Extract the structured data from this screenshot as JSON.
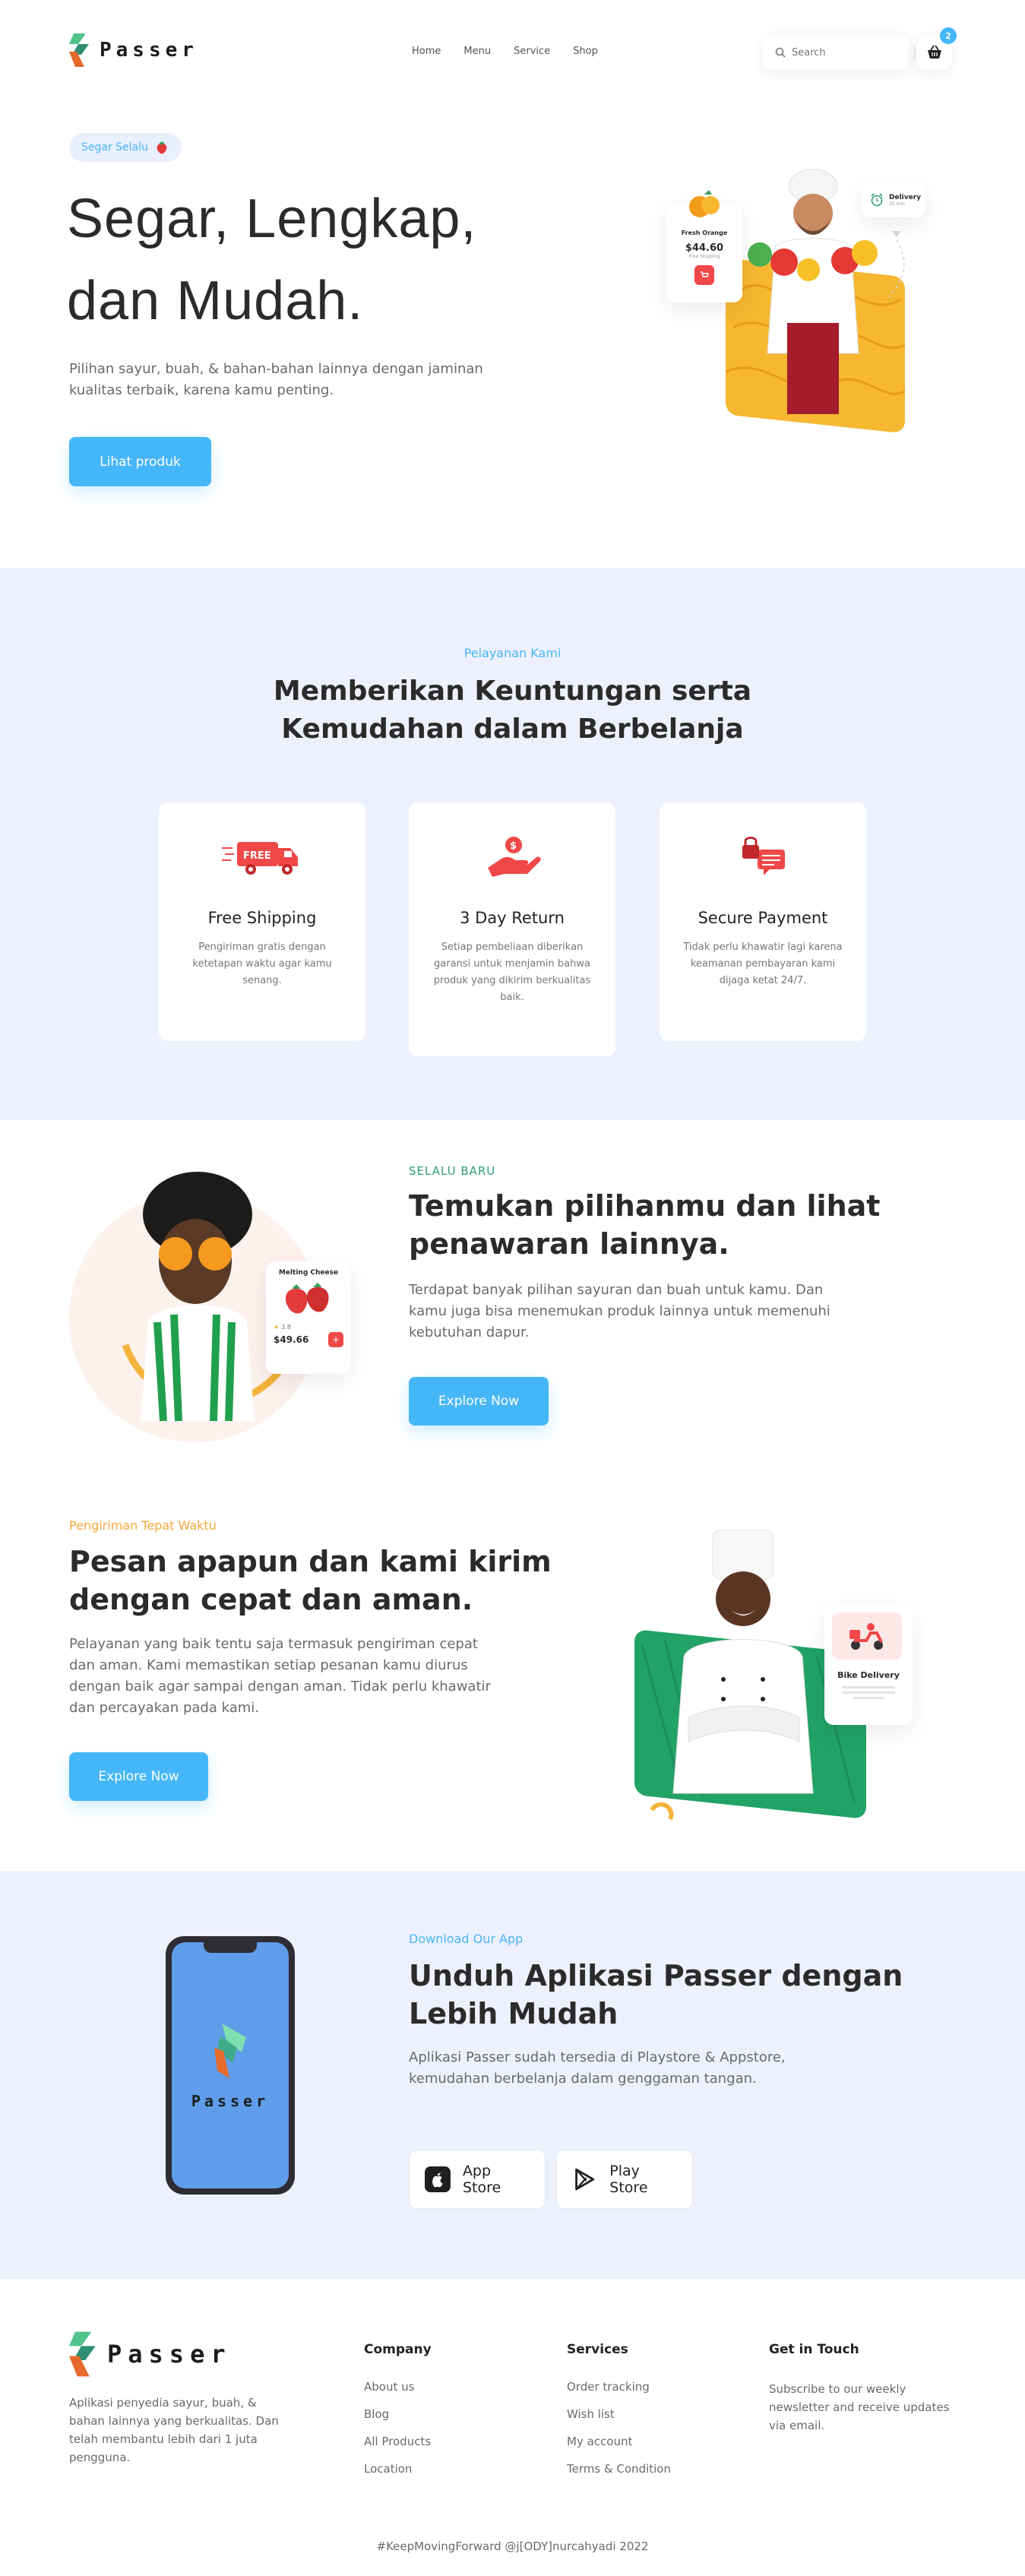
{
  "brand": {
    "name": "Passer",
    "accent": "#45b6f8",
    "green": "#2f9e74",
    "orange": "#f4a63b",
    "red": "#f04848"
  },
  "nav": {
    "links": [
      "Home",
      "Menu",
      "Service",
      "Shop"
    ],
    "search_placeholder": "Search",
    "cart_count": "2"
  },
  "hero": {
    "pill": "Segar Selalu",
    "title_line1": "Segar, Lengkap,",
    "title_line2": "dan Mudah.",
    "description": "Pilihan sayur, buah, & bahan-bahan lainnya dengan jaminan kualitas terbaik, karena kamu penting.",
    "cta": "Lihat produk",
    "product_card": {
      "name": "Fresh Orange",
      "price": "$44.60",
      "note": "Free Shipping"
    },
    "delivery_card": {
      "title": "Delivery",
      "subtitle": "20 min"
    }
  },
  "services": {
    "kicker": "Pelayanan Kami",
    "title_line1": "Memberikan Keuntungan serta",
    "title_line2": "Kemudahan dalam Berbelanja",
    "items": [
      {
        "icon": "free-truck-icon",
        "title": "Free Shipping",
        "desc": "Pengiriman gratis dengan ketetapan waktu agar kamu senang."
      },
      {
        "icon": "hand-money-icon",
        "title": "3 Day Return",
        "desc": "Setiap pembeliaan diberikan garansi untuk menjamin bahwa produk yang dikirim berkualitas baik."
      },
      {
        "icon": "secure-chat-icon",
        "title": "Secure Payment",
        "desc": "Tidak perlu khawatir lagi karena keamanan pembayaran kami dijaga ketat 24/7."
      }
    ]
  },
  "discover": {
    "kicker": "SELALU BARU",
    "title_line1": "Temukan pilihanmu dan lihat",
    "title_line2": "penawaran lainnya.",
    "description": "Terdapat banyak pilihan sayuran dan buah untuk kamu. Dan kamu juga bisa menemukan produk lainnya untuk memenuhi kebutuhan dapur.",
    "cta": "Explore Now",
    "product_card": {
      "name": "Melting Cheese",
      "rating": "3.8",
      "price": "$49.66"
    }
  },
  "delivery": {
    "kicker": "Pengiriman Tepat Waktu",
    "title_line1": "Pesan apapun dan kami kirim",
    "title_line2": "dengan cepat dan aman.",
    "description": "Pelayanan yang baik tentu saja termasuk pengiriman cepat dan aman. Kami memastikan setiap pesanan kamu diurus dengan baik agar sampai dengan aman. Tidak perlu khawatir dan percayakan pada kami.",
    "cta": "Explore Now",
    "bike_card": {
      "title": "Bike Delivery"
    }
  },
  "app": {
    "kicker": "Download Our App",
    "title_line1": "Unduh Aplikasi Passer dengan",
    "title_line2": "Lebih Mudah",
    "description": "Aplikasi Passer sudah tersedia di Playstore & Appstore, kemudahan berbelanja dalam genggaman tangan.",
    "app_store": "App Store",
    "play_store": "Play Store",
    "phone_logo": "Passer"
  },
  "footer": {
    "description": "Aplikasi penyedia sayur, buah, & bahan lainnya yang berkualitas. Dan telah membantu lebih dari 1 juta pengguna.",
    "company": {
      "heading": "Company",
      "links": [
        "About us",
        "Blog",
        "All Products",
        "Location"
      ]
    },
    "services": {
      "heading": "Services",
      "links": [
        "Order tracking",
        "Wish list",
        "My account",
        "Terms & Condition"
      ]
    },
    "contact": {
      "heading": "Get in Touch",
      "text": "Subscribe to our weekly newsletter and receive updates via email."
    },
    "copyright": "#KeepMovingForward @j[ODY]nurcahyadi 2022"
  }
}
